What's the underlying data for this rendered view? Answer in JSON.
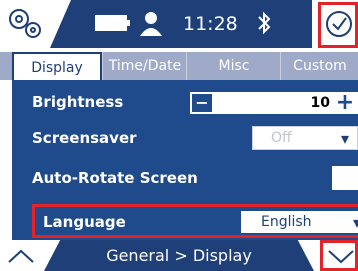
{
  "status": {
    "time": "11:28",
    "icons": [
      "settings-gears-icon",
      "battery-icon",
      "user-icon",
      "bluetooth-icon",
      "check-circle-icon"
    ]
  },
  "tabs": [
    {
      "label": "Display",
      "active": true
    },
    {
      "label": "Time/Date",
      "active": false
    },
    {
      "label": "Misc",
      "active": false
    },
    {
      "label": "Custom",
      "active": false
    }
  ],
  "settings": {
    "brightness": {
      "label": "Brightness",
      "value": "10"
    },
    "screensaver": {
      "label": "Screensaver",
      "value": "Off"
    },
    "autorotate": {
      "label": "Auto-Rotate Screen",
      "checked": false
    },
    "language": {
      "label": "Language",
      "value": "English"
    }
  },
  "footer": {
    "breadcrumb": "General > Display"
  },
  "colors": {
    "primary": "#1f3f78",
    "panel": "#1f4b8c",
    "highlight": "#e2232a",
    "tabbar": "#9eaac8"
  }
}
